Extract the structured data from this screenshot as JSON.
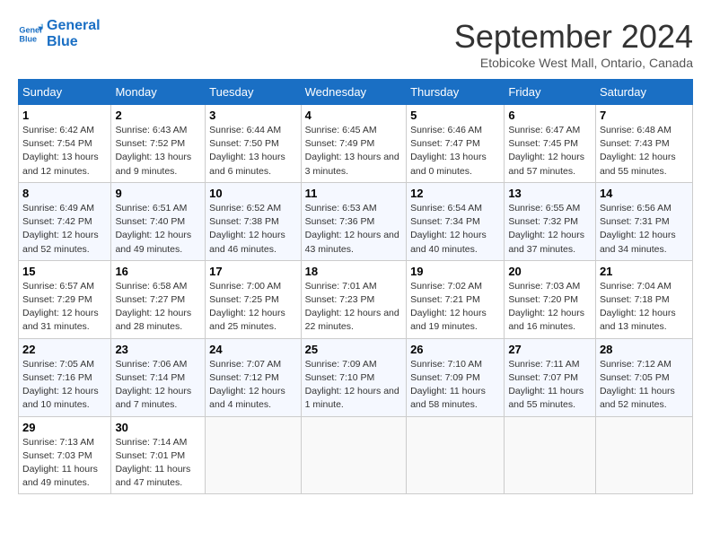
{
  "logo": {
    "line1": "General",
    "line2": "Blue"
  },
  "title": "September 2024",
  "location": "Etobicoke West Mall, Ontario, Canada",
  "days_of_week": [
    "Sunday",
    "Monday",
    "Tuesday",
    "Wednesday",
    "Thursday",
    "Friday",
    "Saturday"
  ],
  "weeks": [
    [
      {
        "day": "1",
        "sunrise": "6:42 AM",
        "sunset": "7:54 PM",
        "daylight": "13 hours and 12 minutes."
      },
      {
        "day": "2",
        "sunrise": "6:43 AM",
        "sunset": "7:52 PM",
        "daylight": "13 hours and 9 minutes."
      },
      {
        "day": "3",
        "sunrise": "6:44 AM",
        "sunset": "7:50 PM",
        "daylight": "13 hours and 6 minutes."
      },
      {
        "day": "4",
        "sunrise": "6:45 AM",
        "sunset": "7:49 PM",
        "daylight": "13 hours and 3 minutes."
      },
      {
        "day": "5",
        "sunrise": "6:46 AM",
        "sunset": "7:47 PM",
        "daylight": "13 hours and 0 minutes."
      },
      {
        "day": "6",
        "sunrise": "6:47 AM",
        "sunset": "7:45 PM",
        "daylight": "12 hours and 57 minutes."
      },
      {
        "day": "7",
        "sunrise": "6:48 AM",
        "sunset": "7:43 PM",
        "daylight": "12 hours and 55 minutes."
      }
    ],
    [
      {
        "day": "8",
        "sunrise": "6:49 AM",
        "sunset": "7:42 PM",
        "daylight": "12 hours and 52 minutes."
      },
      {
        "day": "9",
        "sunrise": "6:51 AM",
        "sunset": "7:40 PM",
        "daylight": "12 hours and 49 minutes."
      },
      {
        "day": "10",
        "sunrise": "6:52 AM",
        "sunset": "7:38 PM",
        "daylight": "12 hours and 46 minutes."
      },
      {
        "day": "11",
        "sunrise": "6:53 AM",
        "sunset": "7:36 PM",
        "daylight": "12 hours and 43 minutes."
      },
      {
        "day": "12",
        "sunrise": "6:54 AM",
        "sunset": "7:34 PM",
        "daylight": "12 hours and 40 minutes."
      },
      {
        "day": "13",
        "sunrise": "6:55 AM",
        "sunset": "7:32 PM",
        "daylight": "12 hours and 37 minutes."
      },
      {
        "day": "14",
        "sunrise": "6:56 AM",
        "sunset": "7:31 PM",
        "daylight": "12 hours and 34 minutes."
      }
    ],
    [
      {
        "day": "15",
        "sunrise": "6:57 AM",
        "sunset": "7:29 PM",
        "daylight": "12 hours and 31 minutes."
      },
      {
        "day": "16",
        "sunrise": "6:58 AM",
        "sunset": "7:27 PM",
        "daylight": "12 hours and 28 minutes."
      },
      {
        "day": "17",
        "sunrise": "7:00 AM",
        "sunset": "7:25 PM",
        "daylight": "12 hours and 25 minutes."
      },
      {
        "day": "18",
        "sunrise": "7:01 AM",
        "sunset": "7:23 PM",
        "daylight": "12 hours and 22 minutes."
      },
      {
        "day": "19",
        "sunrise": "7:02 AM",
        "sunset": "7:21 PM",
        "daylight": "12 hours and 19 minutes."
      },
      {
        "day": "20",
        "sunrise": "7:03 AM",
        "sunset": "7:20 PM",
        "daylight": "12 hours and 16 minutes."
      },
      {
        "day": "21",
        "sunrise": "7:04 AM",
        "sunset": "7:18 PM",
        "daylight": "12 hours and 13 minutes."
      }
    ],
    [
      {
        "day": "22",
        "sunrise": "7:05 AM",
        "sunset": "7:16 PM",
        "daylight": "12 hours and 10 minutes."
      },
      {
        "day": "23",
        "sunrise": "7:06 AM",
        "sunset": "7:14 PM",
        "daylight": "12 hours and 7 minutes."
      },
      {
        "day": "24",
        "sunrise": "7:07 AM",
        "sunset": "7:12 PM",
        "daylight": "12 hours and 4 minutes."
      },
      {
        "day": "25",
        "sunrise": "7:09 AM",
        "sunset": "7:10 PM",
        "daylight": "12 hours and 1 minute."
      },
      {
        "day": "26",
        "sunrise": "7:10 AM",
        "sunset": "7:09 PM",
        "daylight": "11 hours and 58 minutes."
      },
      {
        "day": "27",
        "sunrise": "7:11 AM",
        "sunset": "7:07 PM",
        "daylight": "11 hours and 55 minutes."
      },
      {
        "day": "28",
        "sunrise": "7:12 AM",
        "sunset": "7:05 PM",
        "daylight": "11 hours and 52 minutes."
      }
    ],
    [
      {
        "day": "29",
        "sunrise": "7:13 AM",
        "sunset": "7:03 PM",
        "daylight": "11 hours and 49 minutes."
      },
      {
        "day": "30",
        "sunrise": "7:14 AM",
        "sunset": "7:01 PM",
        "daylight": "11 hours and 47 minutes."
      },
      null,
      null,
      null,
      null,
      null
    ]
  ]
}
